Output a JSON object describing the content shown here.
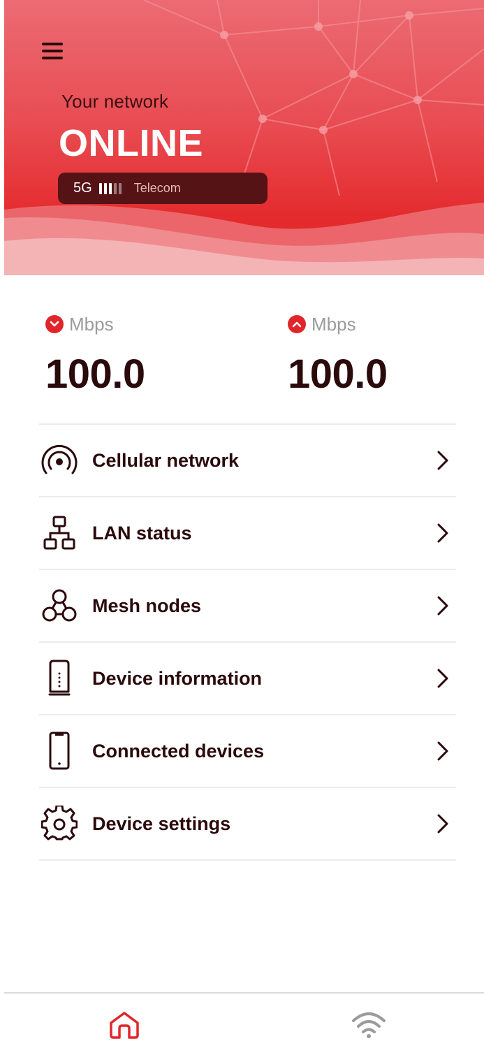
{
  "header": {
    "label": "Your network",
    "status": "ONLINE",
    "network_badge": {
      "generation": "5G",
      "signal_bars_total": 5,
      "signal_bars_strong": 3,
      "carrier": "Telecom"
    },
    "menu_icon": "hamburger-menu-icon"
  },
  "speeds": {
    "download": {
      "icon": "chevron-down-circle-icon",
      "unit": "Mbps",
      "value": "100.0"
    },
    "upload": {
      "icon": "chevron-up-circle-icon",
      "unit": "Mbps",
      "value": "100.0"
    }
  },
  "menu": {
    "items": [
      {
        "label": "Cellular network",
        "icon": "cellular-antenna-icon"
      },
      {
        "label": "LAN status",
        "icon": "lan-network-icon"
      },
      {
        "label": "Mesh nodes",
        "icon": "mesh-nodes-icon"
      },
      {
        "label": "Device information",
        "icon": "router-device-icon"
      },
      {
        "label": "Connected devices",
        "icon": "smartphone-icon"
      },
      {
        "label": "Device settings",
        "icon": "gear-icon"
      }
    ]
  },
  "tabbar": {
    "tabs": [
      {
        "name": "home",
        "icon": "home-icon",
        "active": true
      },
      {
        "name": "wifi",
        "icon": "wifi-icon",
        "active": false
      }
    ]
  },
  "colors": {
    "accent": "#e0262b",
    "badge_bg": "#561316",
    "text_dark": "#2b0a0c",
    "muted": "#9b9b9b"
  }
}
